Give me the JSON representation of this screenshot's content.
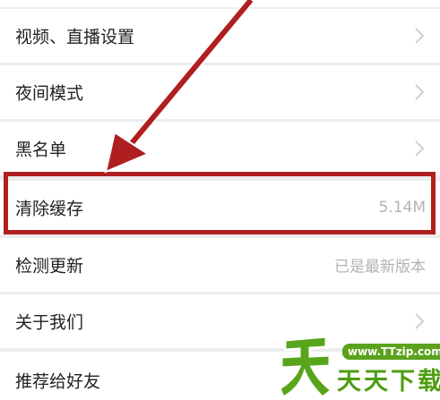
{
  "settings": {
    "items": [
      {
        "label": "视频、直播设置",
        "value": "",
        "chevron": true
      },
      {
        "label": "夜间模式",
        "value": "",
        "chevron": true
      },
      {
        "label": "黑名单",
        "value": "",
        "chevron": true
      },
      {
        "label": "清除缓存",
        "value": "5.14M",
        "chevron": false
      },
      {
        "label": "检测更新",
        "value": "已是最新版本",
        "chevron": false
      },
      {
        "label": "关于我们",
        "value": "",
        "chevron": true
      },
      {
        "label": "推荐给好友",
        "value": "",
        "chevron": false
      }
    ]
  },
  "annotation": {
    "color": "#b01f1f"
  },
  "watermark": {
    "url": "www.TTzip.com",
    "name": "天天下载"
  }
}
